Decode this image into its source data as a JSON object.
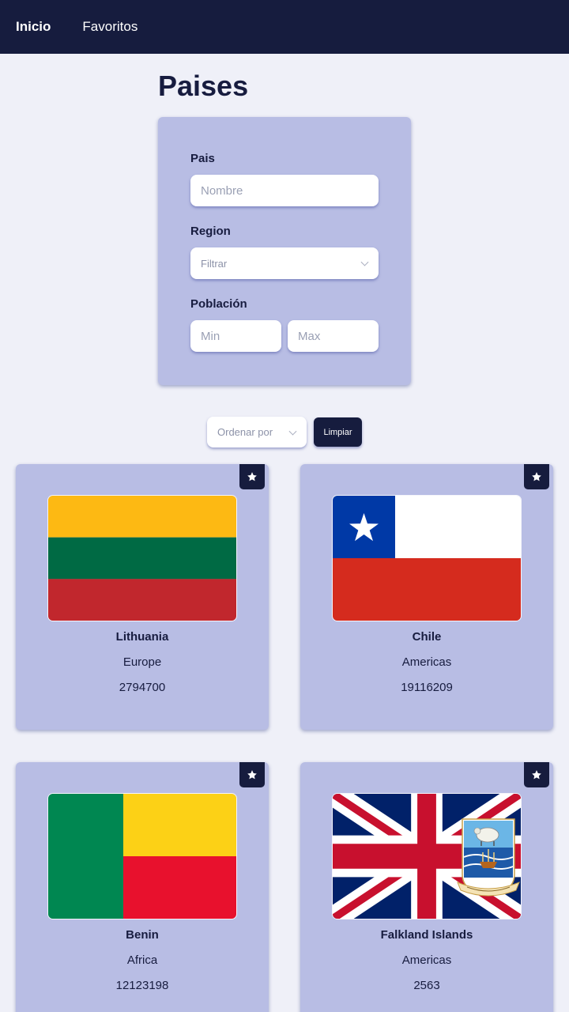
{
  "nav": {
    "home": "Inicio",
    "favorites": "Favoritos"
  },
  "page": {
    "title": "Paises"
  },
  "filters": {
    "country_label": "Pais",
    "country_placeholder": "Nombre",
    "region_label": "Region",
    "region_placeholder": "Filtrar",
    "population_label": "Población",
    "min_placeholder": "Min",
    "max_placeholder": "Max"
  },
  "toolbar": {
    "sort_placeholder": "Ordenar por",
    "clear_label": "Limpiar"
  },
  "countries": [
    {
      "name": "Lithuania",
      "region": "Europe",
      "population": "2794700",
      "flag_icon": "lithuania-flag-icon"
    },
    {
      "name": "Chile",
      "region": "Americas",
      "population": "19116209",
      "flag_icon": "chile-flag-icon"
    },
    {
      "name": "Benin",
      "region": "Africa",
      "population": "12123198",
      "flag_icon": "benin-flag-icon"
    },
    {
      "name": "Falkland Islands",
      "region": "Americas",
      "population": "2563",
      "flag_icon": "falkland-islands-flag-icon"
    }
  ],
  "colors": {
    "navbar": "#161c3e",
    "card": "#b8bde4",
    "background": "#eff0f8",
    "text": "#171c3f"
  }
}
